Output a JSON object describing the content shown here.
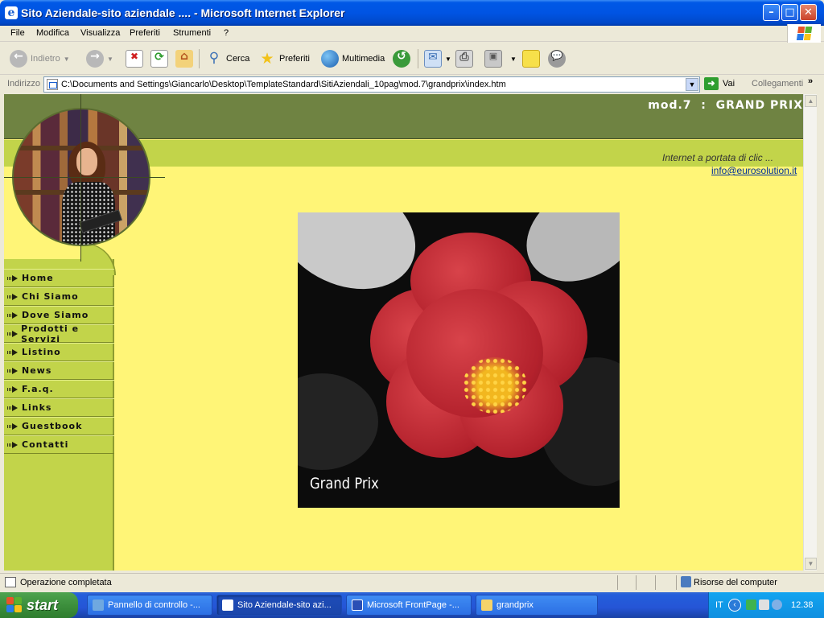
{
  "window": {
    "title": "Sito Aziendale-sito aziendale .... - Microsoft Internet Explorer"
  },
  "menu": [
    "File",
    "Modifica",
    "Visualizza",
    "Preferiti",
    "Strumenti",
    "?"
  ],
  "toolbar": {
    "back": "Indietro",
    "search": "Cerca",
    "favorites": "Preferiti",
    "media": "Multimedia"
  },
  "address": {
    "label": "Indirizzo",
    "url": "C:\\Documents and Settings\\Giancarlo\\Desktop\\TemplateStandard\\SitiAziendali_10pag\\mod.7\\grandprix\\index.htm",
    "go": "Vai",
    "links": "Collegamenti"
  },
  "page": {
    "header_title": "mod.7  :  GRAND PRIX",
    "tagline": "Internet a portata di clic ...",
    "email": "info@eurosolution.it",
    "hero_caption": "Grand Prix",
    "nav": [
      "Home",
      "Chi Siamo",
      "Dove Siamo",
      "Prodotti e Servizi",
      "Listino",
      "News",
      "F.a.q.",
      "Links",
      "Guestbook",
      "Contatti"
    ]
  },
  "status": {
    "text": "Operazione completata",
    "zone": "Risorse del computer"
  },
  "taskbar": {
    "start": "start",
    "tasks": [
      "Pannello di controllo -...",
      "Sito Aziendale-sito azi...",
      "Microsoft FrontPage -...",
      "grandprix"
    ],
    "lang": "IT",
    "clock": "12.38"
  },
  "colors": {
    "header_dark": "#6f8342",
    "header_light": "#c2d44a",
    "content_bg": "#fff577",
    "xp_blue": "#0054e3"
  }
}
